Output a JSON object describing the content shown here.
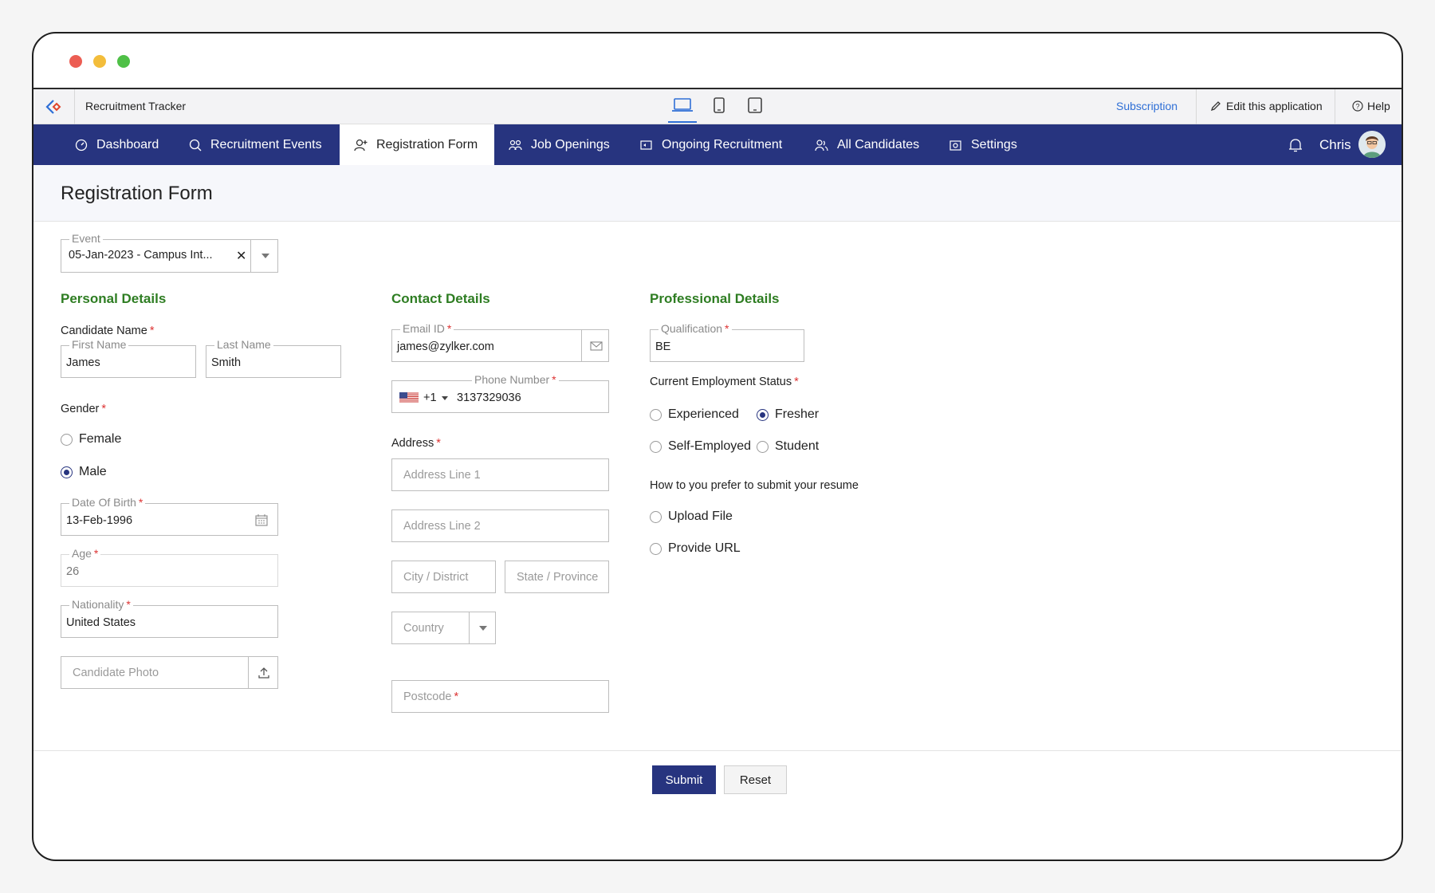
{
  "app": {
    "title": "Recruitment Tracker",
    "subscription": "Subscription",
    "edit_app": "Edit this application",
    "help": "Help"
  },
  "nav": {
    "items": [
      {
        "label": "Dashboard",
        "icon": "dashboard-icon"
      },
      {
        "label": "Recruitment Events",
        "icon": "search-person-icon"
      },
      {
        "label": "Registration Form",
        "icon": "add-user-icon"
      },
      {
        "label": "Job Openings",
        "icon": "team-icon"
      },
      {
        "label": "Ongoing Recruitment",
        "icon": "sync-icon"
      },
      {
        "label": "All Candidates",
        "icon": "users-icon"
      },
      {
        "label": "Settings",
        "icon": "settings-icon"
      }
    ],
    "active": "Registration Form",
    "user": "Chris"
  },
  "page": {
    "title": "Registration Form"
  },
  "form": {
    "event": {
      "label": "Event",
      "value": "05-Jan-2023 - Campus Int..."
    },
    "personal": {
      "heading": "Personal Details",
      "candidate_name_label": "Candidate Name",
      "first_name_label": "First Name",
      "first_name": "James",
      "last_name_label": "Last Name",
      "last_name": "Smith",
      "gender_label": "Gender",
      "gender_options": [
        "Female",
        "Male"
      ],
      "gender_selected": "Male",
      "dob_label": "Date Of Birth",
      "dob": "13-Feb-1996",
      "age_label": "Age",
      "age": "26",
      "nationality_label": "Nationality",
      "nationality": "United States",
      "photo_placeholder": "Candidate Photo"
    },
    "contact": {
      "heading": "Contact Details",
      "email_label": "Email ID",
      "email": "james@zylker.com",
      "phone_label": "Phone Number",
      "phone_code": "+1",
      "phone": "3137329036",
      "address_label": "Address",
      "address1_placeholder": "Address Line 1",
      "address2_placeholder": "Address Line 2",
      "city_placeholder": "City / District",
      "state_placeholder": "State / Province",
      "country_placeholder": "Country",
      "postcode_placeholder": "Postcode"
    },
    "professional": {
      "heading": "Professional Details",
      "qualification_label": "Qualification",
      "qualification": "BE",
      "employment_label": "Current Employment Status",
      "employment_options": [
        "Experienced",
        "Fresher",
        "Self-Employed",
        "Student"
      ],
      "employment_selected": "Fresher",
      "resume_label": "How to you prefer to submit your resume",
      "resume_options": [
        "Upload File",
        "Provide URL"
      ]
    },
    "submit": "Submit",
    "reset": "Reset"
  },
  "colors": {
    "nav_bg": "#27347f",
    "section_heading": "#2e7d22",
    "link": "#2f6fd6",
    "required": "#dd3333"
  }
}
